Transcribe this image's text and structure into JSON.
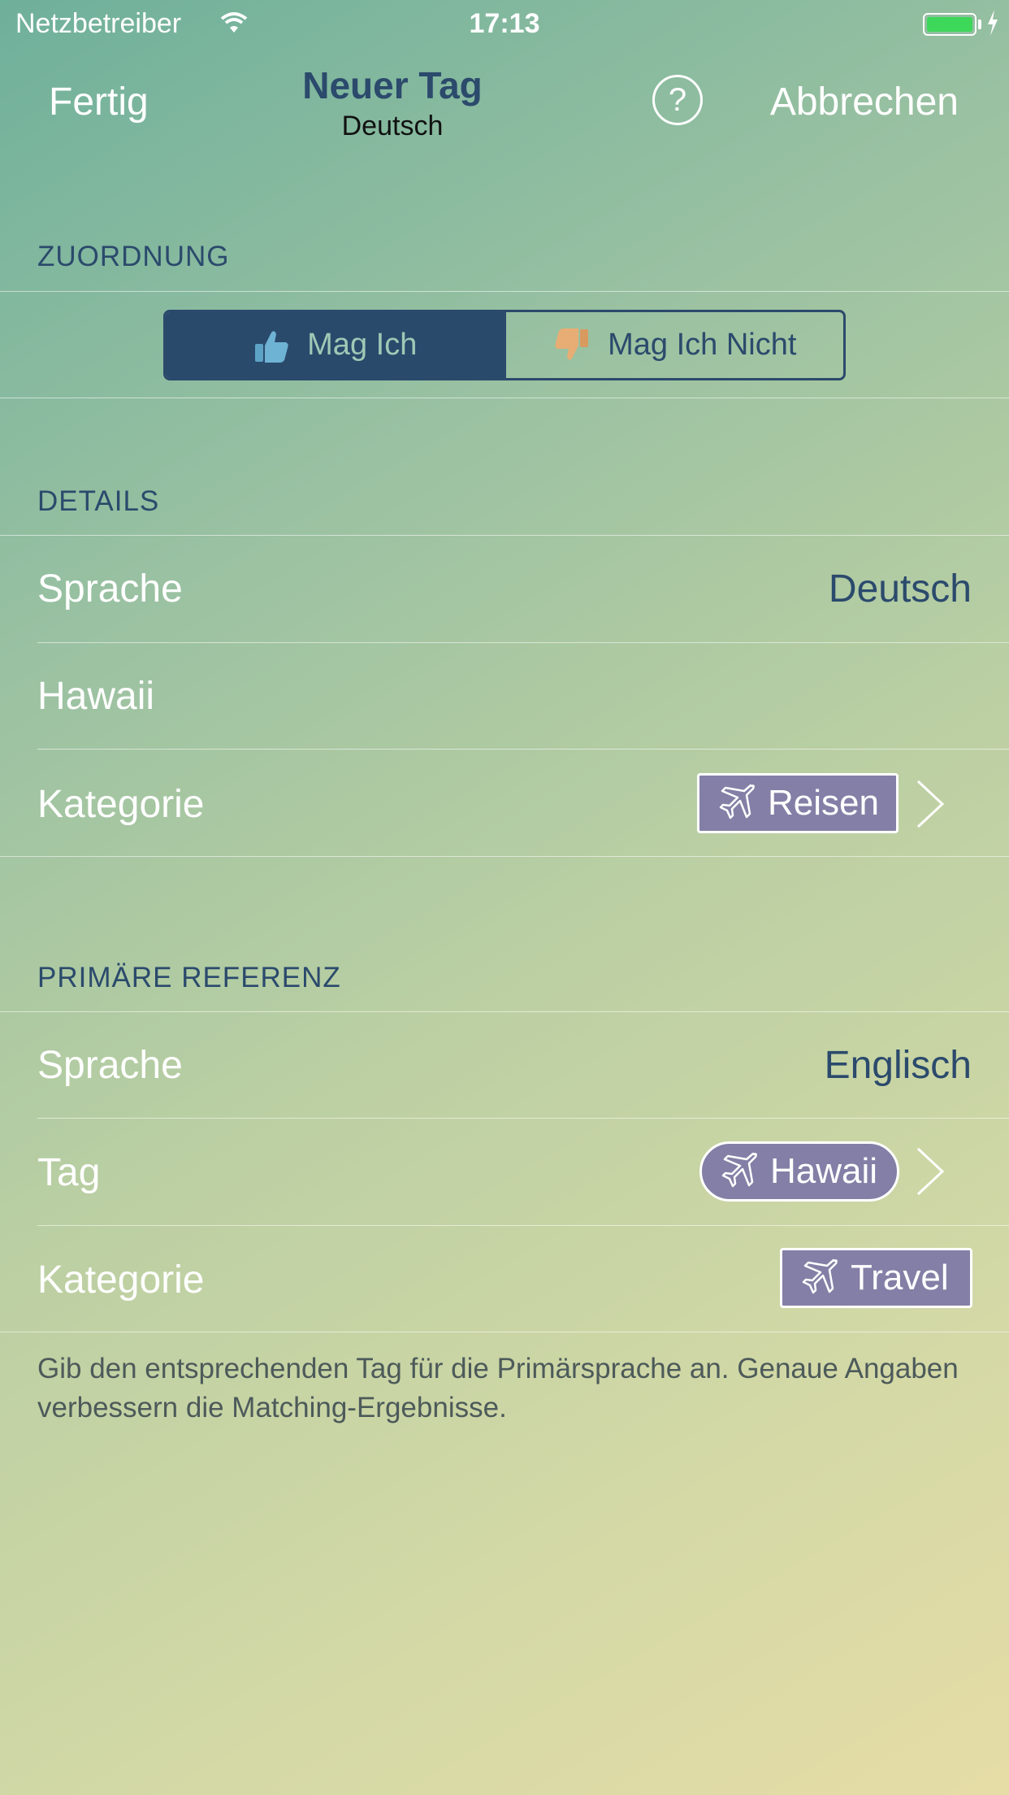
{
  "status_bar": {
    "carrier": "Netzbetreiber",
    "time": "17:13"
  },
  "nav": {
    "left_button": "Fertig",
    "title": "Neuer Tag",
    "subtitle": "Deutsch",
    "help_label": "?",
    "right_button": "Abbrechen"
  },
  "zuordnung": {
    "header": "ZUORDNUNG",
    "options": [
      {
        "label": "Mag Ich",
        "icon": "thumbs-up-icon",
        "selected": true
      },
      {
        "label": "Mag Ich Nicht",
        "icon": "thumbs-down-icon",
        "selected": false
      }
    ]
  },
  "details": {
    "header": "DETAILS",
    "language_label": "Sprache",
    "language_value": "Deutsch",
    "name_value": "Hawaii",
    "category_label": "Kategorie",
    "category_tag": "Reisen",
    "category_icon": "airplane-icon"
  },
  "primary_reference": {
    "header": "PRIMÄRE REFERENZ",
    "language_label": "Sprache",
    "language_value": "Englisch",
    "tag_label": "Tag",
    "tag_value": "Hawaii",
    "category_label": "Kategorie",
    "category_tag": "Travel",
    "footer": "Gib den entsprechenden Tag für die Primärsprache an. Genaue Angaben verbessern die Matching-Ergebnisse."
  },
  "colors": {
    "accent": "#2b4a6c",
    "tag_bg": "#847fa6",
    "battery": "#3dd75a"
  }
}
